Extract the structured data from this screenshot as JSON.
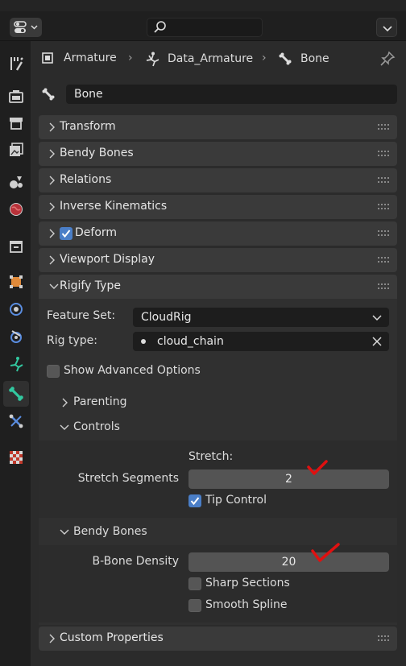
{
  "header": {
    "search_placeholder": ""
  },
  "sidebar_tabs": [
    {
      "name": "tool",
      "active": false
    },
    {
      "name": "render",
      "active": false
    },
    {
      "name": "output",
      "active": false
    },
    {
      "name": "view-layer",
      "active": false
    },
    {
      "name": "scene",
      "active": false
    },
    {
      "name": "world",
      "active": false
    },
    {
      "name": "collection",
      "active": false
    },
    {
      "name": "object",
      "active": false
    },
    {
      "name": "modifiers",
      "active": false
    },
    {
      "name": "physics",
      "active": false
    },
    {
      "name": "object-data",
      "active": false
    },
    {
      "name": "bone",
      "active": true
    },
    {
      "name": "bone-constraints",
      "active": false
    },
    {
      "name": "texture",
      "active": false
    }
  ],
  "breadcrumb": {
    "items": [
      "Armature",
      "Data_Armature",
      "Bone"
    ]
  },
  "bone_name": "Bone",
  "sections": {
    "transform": "Transform",
    "bendy_bones": "Bendy Bones",
    "relations": "Relations",
    "inverse_kinematics": "Inverse Kinematics",
    "deform": "Deform",
    "viewport_display": "Viewport Display",
    "rigify_type": "Rigify Type",
    "custom_properties": "Custom Properties"
  },
  "deform_checked": true,
  "rigify": {
    "feature_set_label": "Feature Set:",
    "feature_set_value": "CloudRig",
    "rig_type_label": "Rig type:",
    "rig_type_value": "cloud_chain",
    "show_advanced_label": "Show Advanced Options",
    "show_advanced_checked": false,
    "parenting_label": "Parenting",
    "controls_label": "Controls",
    "stretch_header": "Stretch:",
    "stretch_segments_label": "Stretch Segments",
    "stretch_segments_value": "2",
    "tip_control_label": "Tip Control",
    "tip_control_checked": true,
    "bendy_bones_label": "Bendy Bones",
    "bbone_density_label": "B-Bone Density",
    "bbone_density_value": "20",
    "sharp_sections_label": "Sharp Sections",
    "sharp_sections_checked": false,
    "smooth_spline_label": "Smooth Spline",
    "smooth_spline_checked": false
  },
  "colors": {
    "accent_checkbox": "#4a7ec7",
    "annotation_mark": "#e01010",
    "active_tab_icon": "#32c8a0"
  }
}
